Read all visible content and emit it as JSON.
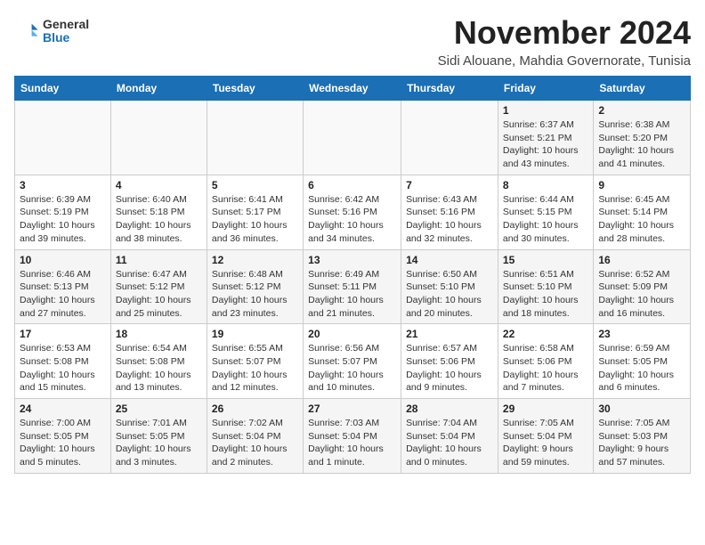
{
  "logo": {
    "general": "General",
    "blue": "Blue"
  },
  "header": {
    "month": "November 2024",
    "location": "Sidi Alouane, Mahdia Governorate, Tunisia"
  },
  "days_of_week": [
    "Sunday",
    "Monday",
    "Tuesday",
    "Wednesday",
    "Thursday",
    "Friday",
    "Saturday"
  ],
  "weeks": [
    [
      {
        "day": "",
        "info": ""
      },
      {
        "day": "",
        "info": ""
      },
      {
        "day": "",
        "info": ""
      },
      {
        "day": "",
        "info": ""
      },
      {
        "day": "",
        "info": ""
      },
      {
        "day": "1",
        "info": "Sunrise: 6:37 AM\nSunset: 5:21 PM\nDaylight: 10 hours and 43 minutes."
      },
      {
        "day": "2",
        "info": "Sunrise: 6:38 AM\nSunset: 5:20 PM\nDaylight: 10 hours and 41 minutes."
      }
    ],
    [
      {
        "day": "3",
        "info": "Sunrise: 6:39 AM\nSunset: 5:19 PM\nDaylight: 10 hours and 39 minutes."
      },
      {
        "day": "4",
        "info": "Sunrise: 6:40 AM\nSunset: 5:18 PM\nDaylight: 10 hours and 38 minutes."
      },
      {
        "day": "5",
        "info": "Sunrise: 6:41 AM\nSunset: 5:17 PM\nDaylight: 10 hours and 36 minutes."
      },
      {
        "day": "6",
        "info": "Sunrise: 6:42 AM\nSunset: 5:16 PM\nDaylight: 10 hours and 34 minutes."
      },
      {
        "day": "7",
        "info": "Sunrise: 6:43 AM\nSunset: 5:16 PM\nDaylight: 10 hours and 32 minutes."
      },
      {
        "day": "8",
        "info": "Sunrise: 6:44 AM\nSunset: 5:15 PM\nDaylight: 10 hours and 30 minutes."
      },
      {
        "day": "9",
        "info": "Sunrise: 6:45 AM\nSunset: 5:14 PM\nDaylight: 10 hours and 28 minutes."
      }
    ],
    [
      {
        "day": "10",
        "info": "Sunrise: 6:46 AM\nSunset: 5:13 PM\nDaylight: 10 hours and 27 minutes."
      },
      {
        "day": "11",
        "info": "Sunrise: 6:47 AM\nSunset: 5:12 PM\nDaylight: 10 hours and 25 minutes."
      },
      {
        "day": "12",
        "info": "Sunrise: 6:48 AM\nSunset: 5:12 PM\nDaylight: 10 hours and 23 minutes."
      },
      {
        "day": "13",
        "info": "Sunrise: 6:49 AM\nSunset: 5:11 PM\nDaylight: 10 hours and 21 minutes."
      },
      {
        "day": "14",
        "info": "Sunrise: 6:50 AM\nSunset: 5:10 PM\nDaylight: 10 hours and 20 minutes."
      },
      {
        "day": "15",
        "info": "Sunrise: 6:51 AM\nSunset: 5:10 PM\nDaylight: 10 hours and 18 minutes."
      },
      {
        "day": "16",
        "info": "Sunrise: 6:52 AM\nSunset: 5:09 PM\nDaylight: 10 hours and 16 minutes."
      }
    ],
    [
      {
        "day": "17",
        "info": "Sunrise: 6:53 AM\nSunset: 5:08 PM\nDaylight: 10 hours and 15 minutes."
      },
      {
        "day": "18",
        "info": "Sunrise: 6:54 AM\nSunset: 5:08 PM\nDaylight: 10 hours and 13 minutes."
      },
      {
        "day": "19",
        "info": "Sunrise: 6:55 AM\nSunset: 5:07 PM\nDaylight: 10 hours and 12 minutes."
      },
      {
        "day": "20",
        "info": "Sunrise: 6:56 AM\nSunset: 5:07 PM\nDaylight: 10 hours and 10 minutes."
      },
      {
        "day": "21",
        "info": "Sunrise: 6:57 AM\nSunset: 5:06 PM\nDaylight: 10 hours and 9 minutes."
      },
      {
        "day": "22",
        "info": "Sunrise: 6:58 AM\nSunset: 5:06 PM\nDaylight: 10 hours and 7 minutes."
      },
      {
        "day": "23",
        "info": "Sunrise: 6:59 AM\nSunset: 5:05 PM\nDaylight: 10 hours and 6 minutes."
      }
    ],
    [
      {
        "day": "24",
        "info": "Sunrise: 7:00 AM\nSunset: 5:05 PM\nDaylight: 10 hours and 5 minutes."
      },
      {
        "day": "25",
        "info": "Sunrise: 7:01 AM\nSunset: 5:05 PM\nDaylight: 10 hours and 3 minutes."
      },
      {
        "day": "26",
        "info": "Sunrise: 7:02 AM\nSunset: 5:04 PM\nDaylight: 10 hours and 2 minutes."
      },
      {
        "day": "27",
        "info": "Sunrise: 7:03 AM\nSunset: 5:04 PM\nDaylight: 10 hours and 1 minute."
      },
      {
        "day": "28",
        "info": "Sunrise: 7:04 AM\nSunset: 5:04 PM\nDaylight: 10 hours and 0 minutes."
      },
      {
        "day": "29",
        "info": "Sunrise: 7:05 AM\nSunset: 5:04 PM\nDaylight: 9 hours and 59 minutes."
      },
      {
        "day": "30",
        "info": "Sunrise: 7:05 AM\nSunset: 5:03 PM\nDaylight: 9 hours and 57 minutes."
      }
    ]
  ]
}
